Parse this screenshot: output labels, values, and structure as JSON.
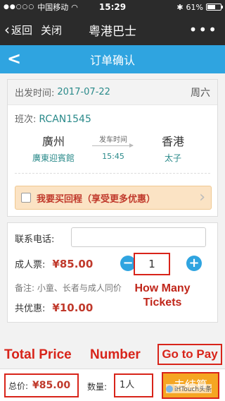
{
  "status_bar": {
    "carrier": "中国移动",
    "time": "15:29",
    "battery": "61%",
    "battery_level": 0.61
  },
  "wechat_nav": {
    "back": "返回",
    "close": "关闭",
    "title": "粤港巴士",
    "more": "•••"
  },
  "header": {
    "title": "订单确认"
  },
  "trip": {
    "date_label": "出发时间:",
    "date": "2017-07-22",
    "weekday": "周六",
    "route_label": "班次:",
    "route_no": "RCAN1545",
    "from_city": "廣州",
    "from_stop": "廣東迎賓館",
    "to_city": "香港",
    "to_stop": "太子",
    "depart_label": "发车时间",
    "depart_time": "15:45",
    "return_text": "我要买回程（享受更多优惠）"
  },
  "form": {
    "phone_label": "联系电话:",
    "phone_value": "",
    "adult_label": "成人票:",
    "adult_price": "¥85.00",
    "quantity": "1",
    "minus": "−",
    "plus": "+",
    "note": "备注: 小童、长者与成人同价",
    "discount_label": "共优惠:",
    "discount": "¥10.00"
  },
  "annotations": {
    "tickets": "How Many Tickets",
    "total_price": "Total Price",
    "number": "Number",
    "go_to_pay": "Go to Pay"
  },
  "bottom": {
    "total_label": "总价:",
    "total": "¥85.00",
    "qty_label": "数量:",
    "qty": "1人",
    "pay_button": "去结算"
  },
  "watermark": "iHTouch头条"
}
